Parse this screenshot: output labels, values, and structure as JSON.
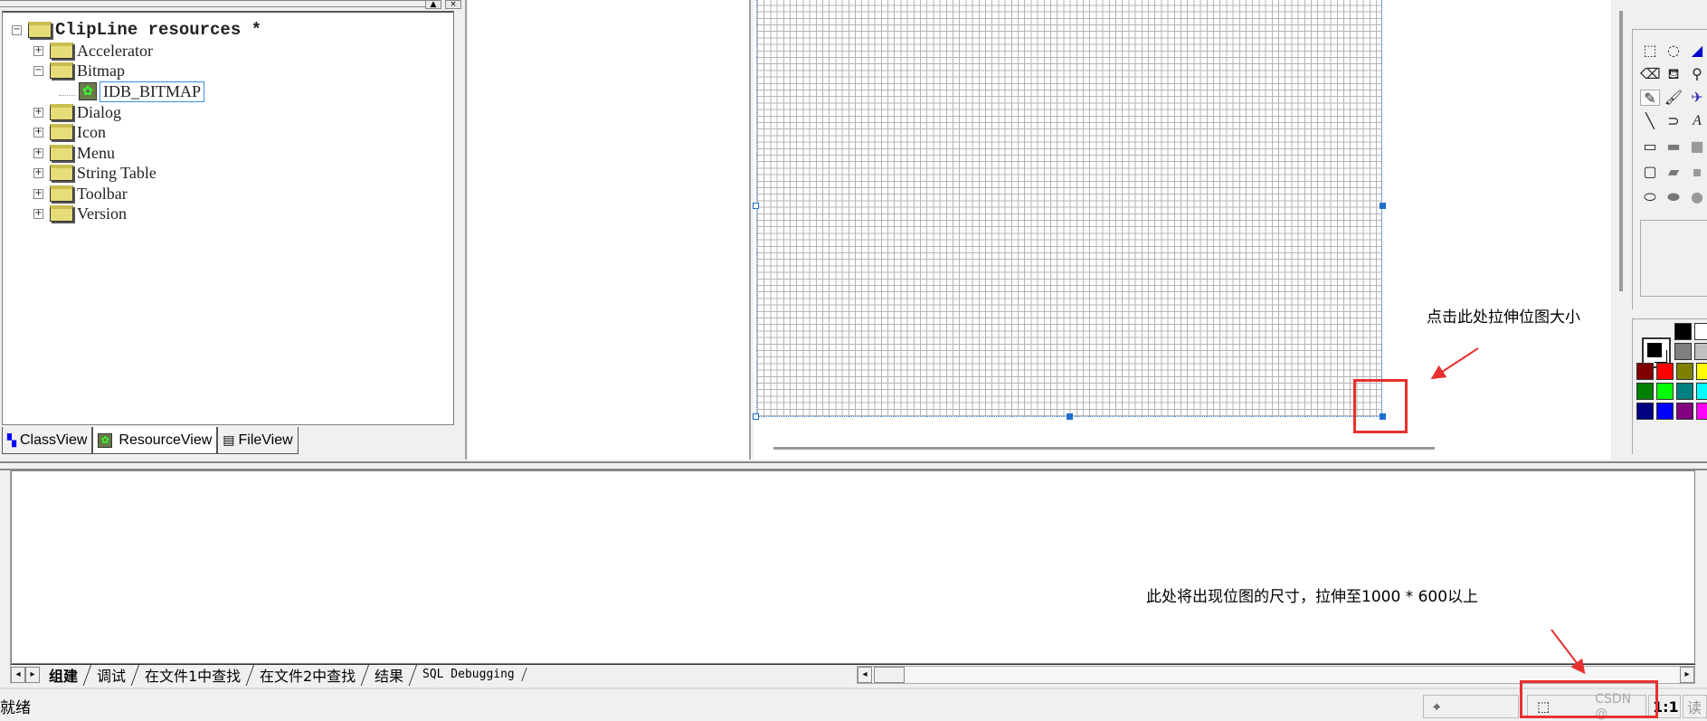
{
  "tree": {
    "root": "ClipLine resources *",
    "items": [
      {
        "label": "Accelerator",
        "expanded": false
      },
      {
        "label": "Bitmap",
        "expanded": true,
        "children": [
          "IDB_BITMAP"
        ]
      },
      {
        "label": "Dialog",
        "expanded": false
      },
      {
        "label": "Icon",
        "expanded": false
      },
      {
        "label": "Menu",
        "expanded": false
      },
      {
        "label": "String Table",
        "expanded": false
      },
      {
        "label": "Toolbar",
        "expanded": false
      },
      {
        "label": "Version",
        "expanded": false
      }
    ]
  },
  "left_tabs": [
    {
      "label": "ClassView"
    },
    {
      "label": "ResourceView"
    },
    {
      "label": "FileView"
    }
  ],
  "output_tabs": [
    {
      "label": "组建"
    },
    {
      "label": "调试"
    },
    {
      "label": "在文件1中查找"
    },
    {
      "label": "在文件2中查找"
    },
    {
      "label": "结果"
    },
    {
      "label": "SQL Debugging"
    }
  ],
  "status": {
    "text": "就绪",
    "zoom": "1:1",
    "readonly": "读"
  },
  "watermark": "CSDN @",
  "annotations": {
    "resize_hint": "点击此处拉伸位图大小",
    "size_hint": "此处将出现位图的尺寸，拉伸至1000 * 600以上"
  },
  "palette": [
    "#000000",
    "#ffffff",
    "#808080",
    "#c0c0c0",
    "#800000",
    "#ff0000",
    "#808000",
    "#ffff00",
    "#008000",
    "#00ff00",
    "#008080",
    "#00ffff",
    "#000080",
    "#0000ff",
    "#800080",
    "#ff00ff"
  ],
  "accent": "#e83030"
}
